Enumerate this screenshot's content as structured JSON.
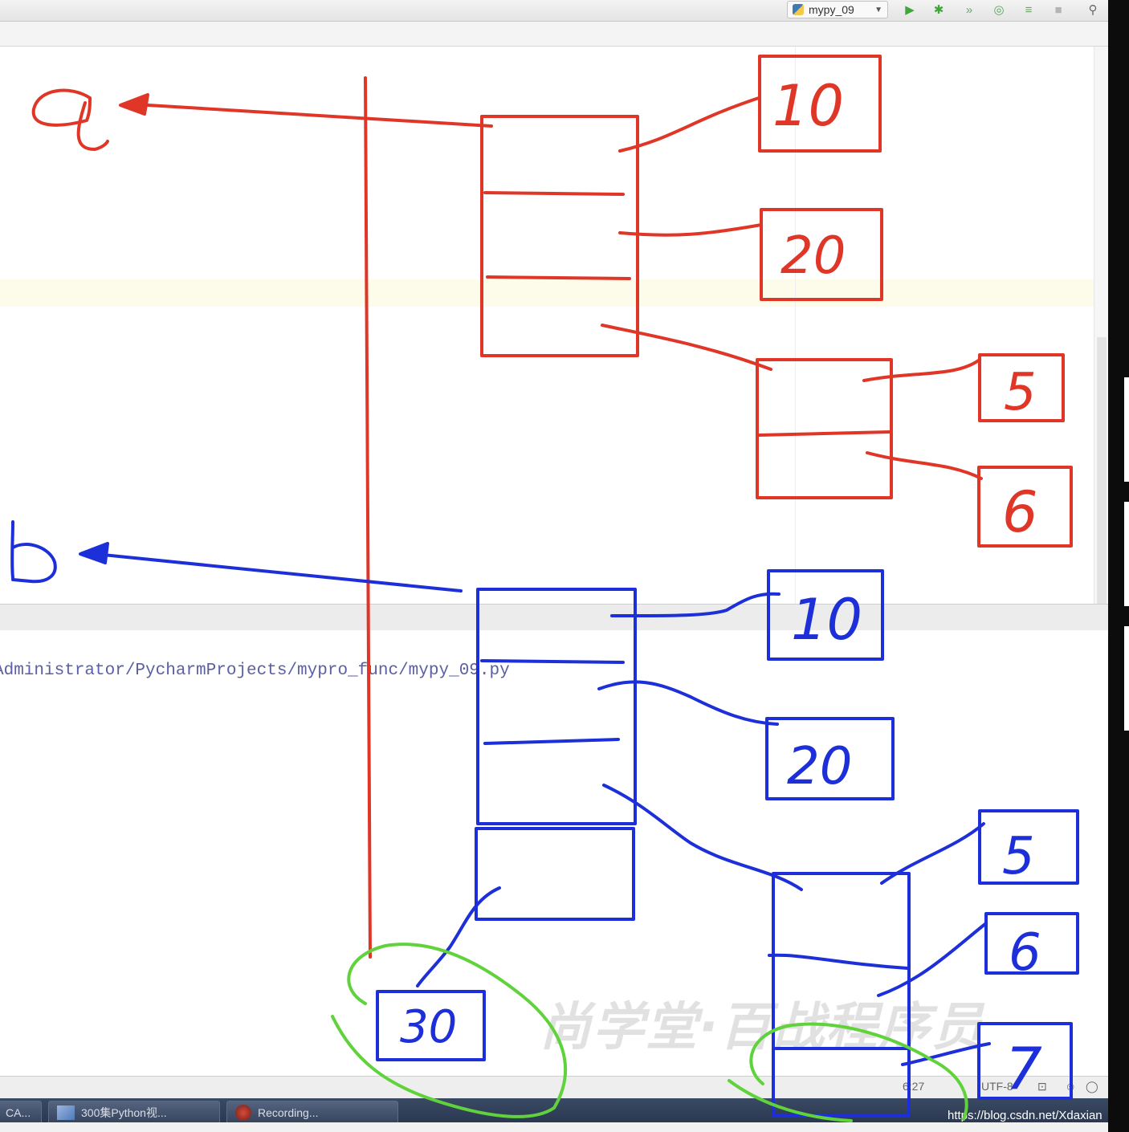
{
  "toolbar": {
    "run_config_label": "mypy_09",
    "icons": [
      "run-icon",
      "debug-icon",
      "step-icon",
      "coverage-icon",
      "profile-icon",
      "stop-icon",
      "search-icon"
    ]
  },
  "console": {
    "path_text": "Administrator/PycharmProjects/mypro_func/mypy_09.py",
    "gear_glyph": "⚙-",
    "pin_glyph": "⊥"
  },
  "status": {
    "position": "6:27",
    "encoding": "UTF-8"
  },
  "taskbar": {
    "items": [
      {
        "label": "CA..."
      },
      {
        "label": "300集Python视..."
      },
      {
        "label": "Recording..."
      }
    ]
  },
  "watermarks": {
    "chinese": "尚学堂·百战程序员",
    "url": "https://blog.csdn.net/Xdaxian"
  },
  "drawing": {
    "a_label": "a",
    "b_label": "b",
    "red_numbers": [
      "10",
      "20",
      "5",
      "6"
    ],
    "blue_numbers": [
      "10",
      "20",
      "5",
      "6",
      "7",
      "30"
    ],
    "colors": {
      "red": "#e03628",
      "blue": "#1c2fd8",
      "green": "#5fd23c"
    }
  }
}
